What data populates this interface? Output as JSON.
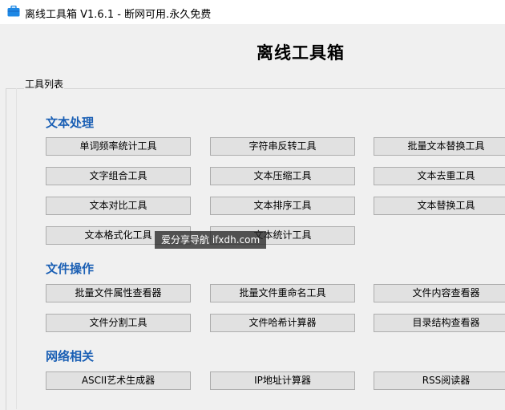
{
  "window": {
    "title": "离线工具箱 V1.6.1 - 断网可用.永久免费",
    "icon": "briefcase-icon",
    "icon_color": "#1e88e5"
  },
  "header": {
    "title": "离线工具箱"
  },
  "group": {
    "label": "工具列表"
  },
  "sections": {
    "text": {
      "title": "文本处理",
      "buttons": [
        "单词频率统计工具",
        "字符串反转工具",
        "批量文本替换工具",
        "文字组合工具",
        "文本压缩工具",
        "文本去重工具",
        "文本对比工具",
        "文本排序工具",
        "文本替换工具",
        "文本格式化工具",
        "文本统计工具"
      ]
    },
    "file": {
      "title": "文件操作",
      "buttons": [
        "批量文件属性查看器",
        "批量文件重命名工具",
        "文件内容查看器",
        "文件分割工具",
        "文件哈希计算器",
        "目录结构查看器"
      ]
    },
    "network": {
      "title": "网络相关",
      "buttons": [
        "ASCII艺术生成器",
        "IP地址计算器",
        "RSS阅读器"
      ]
    }
  },
  "watermark": {
    "text": "爱分享导航 ifxdh.com"
  },
  "colors": {
    "section_title": "#1a5fb4",
    "button_bg": "#e1e1e1",
    "button_border": "#adadad",
    "window_bg": "#f0f0f0"
  }
}
